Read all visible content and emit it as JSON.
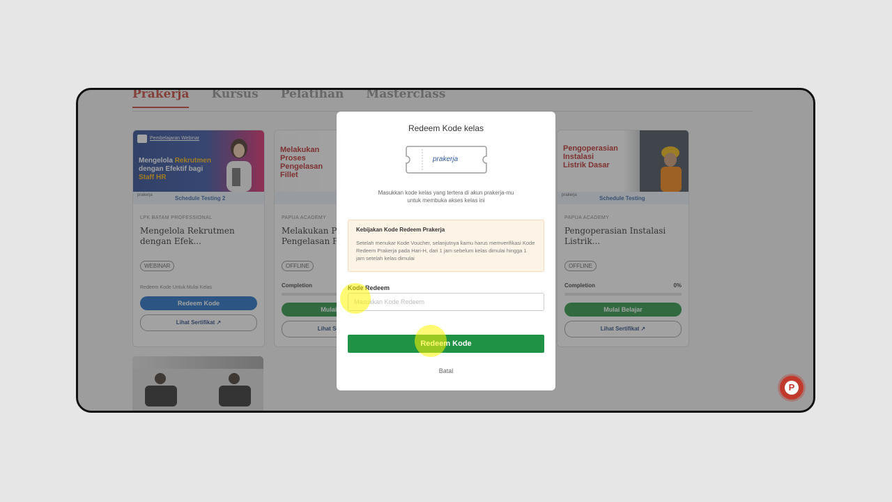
{
  "tabs": [
    "Prakerja",
    "Kursus",
    "Pelatihan",
    "Masterclass"
  ],
  "cards": [
    {
      "banner_badge": "Pembelajaran Webinar",
      "banner_title_1": "Mengelola ",
      "banner_title_highlight": "Rekrutmen",
      "banner_title_2": "dengan Efektif bagi",
      "banner_title_3": "Staff HR",
      "strip_logo": "prakerja",
      "schedule": "Schedule Testing 2",
      "provider": "LPK BATAM PROFESSIONAL",
      "title": "Mengelola Rekrutmen dengan Efek...",
      "tag": "WEBINAR",
      "note": "Redeem Kode Untuk Mulai Kelas",
      "primary": "Redeem Kode",
      "secondary": "Lihat Sertifikat"
    },
    {
      "banner_title_1": "Melakukan",
      "banner_title_2": "Proses",
      "banner_title_3": "Pengelasan",
      "banner_title_4": "Fillet",
      "provider": "PAPUA ACADEMY",
      "title": "Melakukan Proses Pengelasan Fil...",
      "tag": "OFFLINE",
      "completion_label": "Completion",
      "primary": "Mulai Belajar",
      "secondary": "Lihat Sertifikat"
    },
    {
      "banner_title_1": "Pengoperasian",
      "banner_title_2": "Instalasi",
      "banner_title_3": "Listrik Dasar",
      "strip_logo": "prakerja",
      "schedule": "Schedule Testing",
      "provider": "PAPUA ACADEMY",
      "title": "Pengoperasian Instalasi Listrik...",
      "tag": "OFFLINE",
      "completion_label": "Completion",
      "completion_value": "0%",
      "primary": "Mulai Belajar",
      "secondary": "Lihat Sertifikat"
    }
  ],
  "modal": {
    "title": "Redeem Kode kelas",
    "logo_text": "prakerja",
    "subtitle_1": "Masukkan kode kelas yang tertera di akun prakerja-mu",
    "subtitle_2": "untuk membuka akses kelas ini",
    "policy_title": "Kebijakan Kode Redeem Prakerja",
    "policy_text": "Setelah menukar Kode Voucher, selanjutnya kamu harus memverifikasi Kode Redeem Prakerja pada Hari-H, dari 1 jam sebelum kelas dimulai hingga 1 jam setelah kelas dimulai",
    "field_label": "Kode Redeem",
    "field_placeholder": "Masukkan Kode Redeem",
    "submit": "Redeem Kode",
    "cancel": "Batal"
  },
  "colors": {
    "accent_red": "#c0392b",
    "primary_blue": "#1565c0",
    "primary_green": "#1f9245",
    "policy_bg": "#fdf3e6"
  },
  "fab_icon": "p-logo-icon",
  "fab_letter": "P"
}
